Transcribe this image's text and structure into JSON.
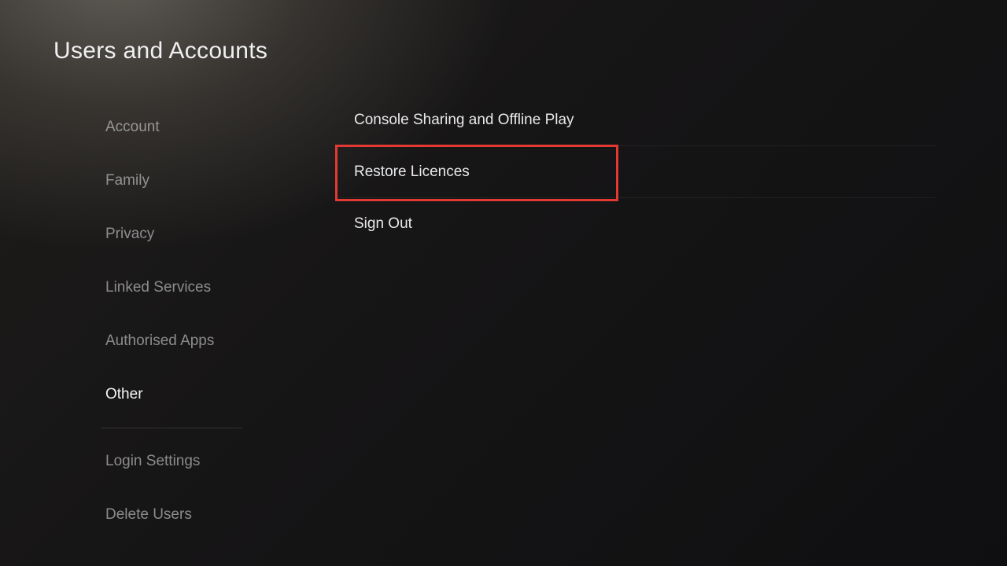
{
  "header": {
    "title": "Users and Accounts"
  },
  "sidebar": {
    "groups": [
      {
        "items": [
          {
            "id": "account",
            "label": "Account",
            "selected": false
          },
          {
            "id": "family",
            "label": "Family",
            "selected": false
          },
          {
            "id": "privacy",
            "label": "Privacy",
            "selected": false
          },
          {
            "id": "linked-services",
            "label": "Linked Services",
            "selected": false
          },
          {
            "id": "authorised-apps",
            "label": "Authorised Apps",
            "selected": false
          },
          {
            "id": "other",
            "label": "Other",
            "selected": true
          }
        ]
      },
      {
        "items": [
          {
            "id": "login-settings",
            "label": "Login Settings",
            "selected": false
          },
          {
            "id": "delete-users",
            "label": "Delete Users",
            "selected": false
          }
        ]
      }
    ]
  },
  "content": {
    "items": [
      {
        "id": "console-sharing",
        "label": "Console Sharing and Offline Play",
        "highlighted": false
      },
      {
        "id": "restore-licences",
        "label": "Restore Licences",
        "highlighted": true
      },
      {
        "id": "sign-out",
        "label": "Sign Out",
        "highlighted": false
      }
    ]
  },
  "annotation": {
    "highlight_color": "#e23a32"
  }
}
